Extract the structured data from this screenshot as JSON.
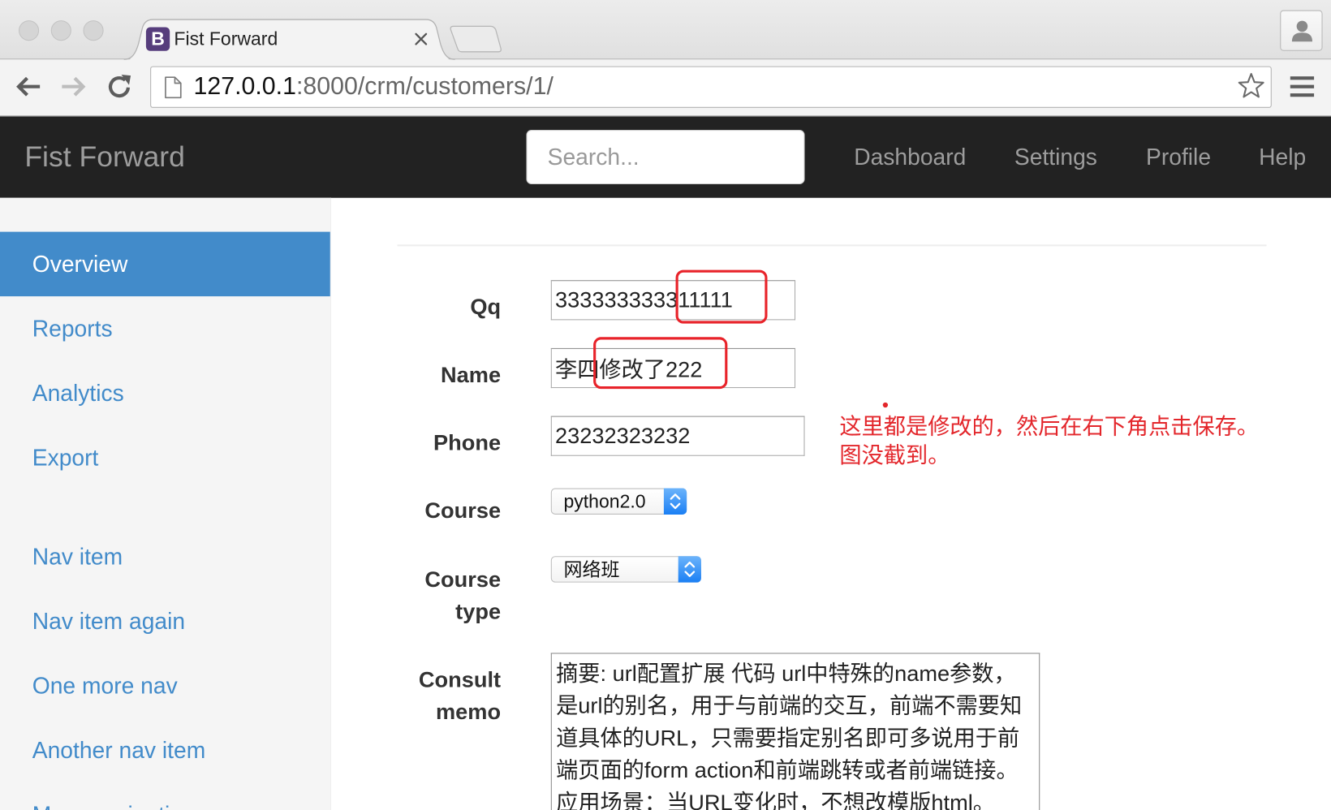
{
  "browser": {
    "tab": {
      "title": "Fist Forward",
      "favicon_letter": "B"
    },
    "url": {
      "host": "127.0.0.1",
      "path": ":8000/crm/customers/1/"
    }
  },
  "navbar": {
    "brand": "Fist Forward",
    "search": {
      "placeholder": "Search..."
    },
    "links": [
      {
        "label": "Dashboard"
      },
      {
        "label": "Settings"
      },
      {
        "label": "Profile"
      },
      {
        "label": "Help"
      }
    ]
  },
  "sidebar": {
    "primary": [
      {
        "label": "Overview",
        "active": true
      },
      {
        "label": "Reports",
        "active": false
      },
      {
        "label": "Analytics",
        "active": false
      },
      {
        "label": "Export",
        "active": false
      }
    ],
    "secondary": [
      {
        "label": "Nav item"
      },
      {
        "label": "Nav item again"
      },
      {
        "label": "One more nav"
      },
      {
        "label": "Another nav item"
      },
      {
        "label": "More navigation"
      }
    ]
  },
  "form": {
    "qq": {
      "label": "Qq",
      "value": "333333333311111"
    },
    "name": {
      "label": "Name",
      "value": "李四修改了222"
    },
    "phone": {
      "label": "Phone",
      "value": "23232323232"
    },
    "course": {
      "label": "Course",
      "selected": "python2.0"
    },
    "course_type": {
      "label": "Course type",
      "selected": "网络班"
    },
    "consult_memo": {
      "label": "Consult memo",
      "value": "摘要: url配置扩展 代码 url中特殊的name参数，是url的别名，用于与前端的交互，前端不需要知道具体的URL，只需要指定别名即可多说用于前端页面的form action和前端跳转或者前端链接。应用场景：当URL变化时，不想改模版html。"
    }
  },
  "annotation": {
    "text": "这里都是修改的，然后在右下角点击保存。图没截到。"
  },
  "colors": {
    "navbar_bg": "#222222",
    "navbar_text": "#9d9d9d",
    "link": "#428bca",
    "active_bg": "#428bca",
    "sidebar_bg": "#f5f5f5",
    "annotation_red": "#e3262b",
    "favicon_bg": "#563d7c",
    "select_stepper": "#1a7ff4"
  },
  "icons": {
    "window_controls": [
      "close-window-icon",
      "minimize-window-icon",
      "zoom-window-icon"
    ],
    "tab_close": "close-icon",
    "new_tab": "new-tab-icon",
    "user": "user-icon",
    "back": "back-arrow-icon",
    "forward": "forward-arrow-icon",
    "reload": "reload-icon",
    "page": "page-icon",
    "bookmark": "star-icon",
    "menu": "menu-icon",
    "select": "select-stepper-icon"
  }
}
